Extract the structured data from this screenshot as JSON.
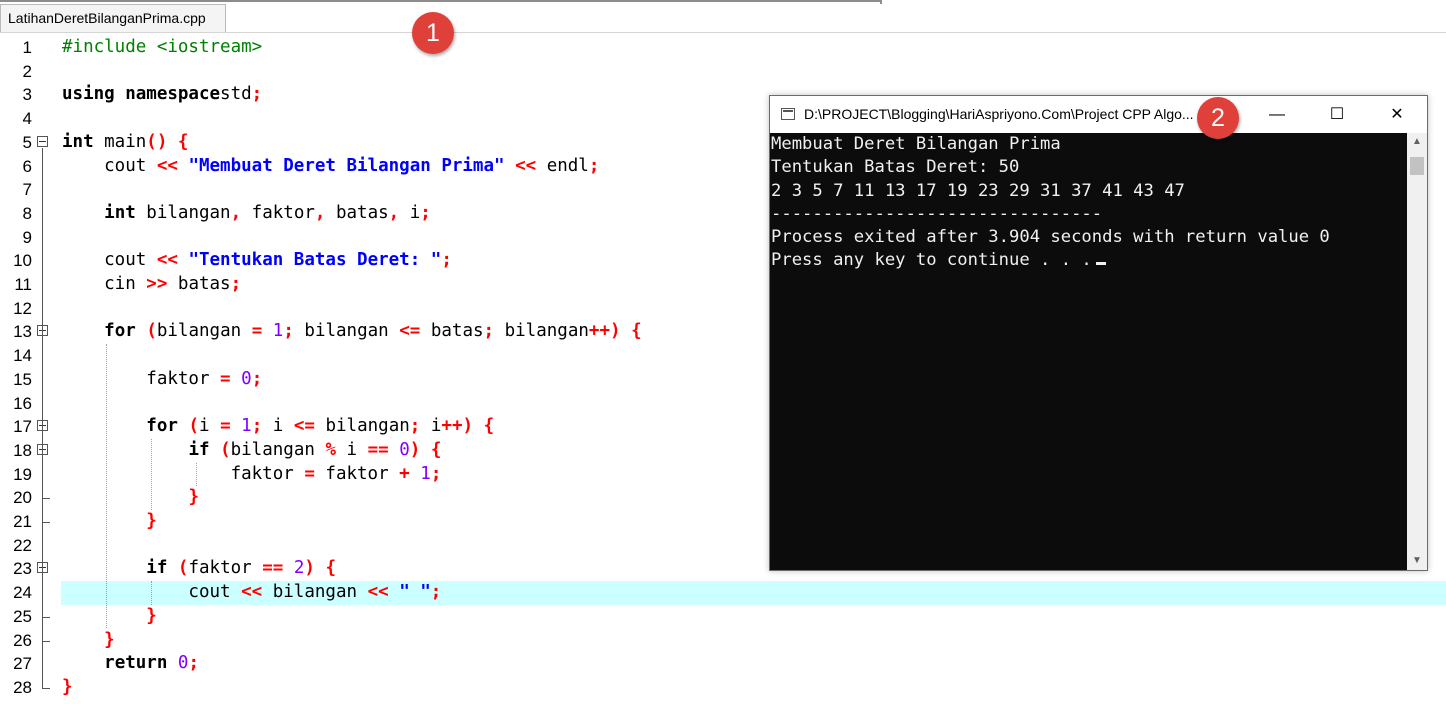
{
  "tab": {
    "filename": "LatihanDeretBilanganPrima.cpp"
  },
  "editor": {
    "highlighted_line": 24,
    "lines": [
      {
        "n": "1",
        "code": [
          [
            "pp",
            "#include <iostream>"
          ]
        ]
      },
      {
        "n": "2",
        "code": []
      },
      {
        "n": "3",
        "code": [
          [
            "kw",
            "using namespace"
          ],
          [
            "",
            "std"
          ],
          [
            "sym",
            ";"
          ]
        ]
      },
      {
        "n": "4",
        "code": []
      },
      {
        "n": "5",
        "code": [
          [
            "kw",
            "int"
          ],
          [
            "",
            " main"
          ],
          [
            "sym",
            "()"
          ],
          [
            "",
            " "
          ],
          [
            "sym",
            "{"
          ]
        ]
      },
      {
        "n": "6",
        "code": [
          [
            "",
            "    cout "
          ],
          [
            "sym",
            "<<"
          ],
          [
            "",
            " "
          ],
          [
            "str",
            "\"Membuat Deret Bilangan Prima\""
          ],
          [
            "",
            " "
          ],
          [
            "sym",
            "<<"
          ],
          [
            "",
            " endl"
          ],
          [
            "sym",
            ";"
          ]
        ]
      },
      {
        "n": "7",
        "code": []
      },
      {
        "n": "8",
        "code": [
          [
            "",
            "    "
          ],
          [
            "kw",
            "int"
          ],
          [
            "",
            " bilangan"
          ],
          [
            "sym",
            ","
          ],
          [
            "",
            " faktor"
          ],
          [
            "sym",
            ","
          ],
          [
            "",
            " batas"
          ],
          [
            "sym",
            ","
          ],
          [
            "",
            " i"
          ],
          [
            "sym",
            ";"
          ]
        ]
      },
      {
        "n": "9",
        "code": []
      },
      {
        "n": "10",
        "code": [
          [
            "",
            "    cout "
          ],
          [
            "sym",
            "<<"
          ],
          [
            "",
            " "
          ],
          [
            "str",
            "\"Tentukan Batas Deret: \""
          ],
          [
            "sym",
            ";"
          ]
        ]
      },
      {
        "n": "11",
        "code": [
          [
            "",
            "    cin "
          ],
          [
            "sym",
            ">>"
          ],
          [
            "",
            " batas"
          ],
          [
            "sym",
            ";"
          ]
        ]
      },
      {
        "n": "12",
        "code": []
      },
      {
        "n": "13",
        "code": [
          [
            "",
            "    "
          ],
          [
            "kw",
            "for"
          ],
          [
            "",
            " "
          ],
          [
            "sym",
            "("
          ],
          [
            "",
            "bilangan "
          ],
          [
            "sym",
            "="
          ],
          [
            "",
            " "
          ],
          [
            "num",
            "1"
          ],
          [
            "sym",
            ";"
          ],
          [
            "",
            " bilangan "
          ],
          [
            "sym",
            "<="
          ],
          [
            "",
            " batas"
          ],
          [
            "sym",
            ";"
          ],
          [
            "",
            " bilangan"
          ],
          [
            "sym",
            "++)"
          ],
          [
            "",
            " "
          ],
          [
            "sym",
            "{"
          ]
        ]
      },
      {
        "n": "14",
        "code": []
      },
      {
        "n": "15",
        "code": [
          [
            "",
            "        faktor "
          ],
          [
            "sym",
            "="
          ],
          [
            "",
            " "
          ],
          [
            "num",
            "0"
          ],
          [
            "sym",
            ";"
          ]
        ]
      },
      {
        "n": "16",
        "code": []
      },
      {
        "n": "17",
        "code": [
          [
            "",
            "        "
          ],
          [
            "kw",
            "for"
          ],
          [
            "",
            " "
          ],
          [
            "sym",
            "("
          ],
          [
            "",
            "i "
          ],
          [
            "sym",
            "="
          ],
          [
            "",
            " "
          ],
          [
            "num",
            "1"
          ],
          [
            "sym",
            ";"
          ],
          [
            "",
            " i "
          ],
          [
            "sym",
            "<="
          ],
          [
            "",
            " bilangan"
          ],
          [
            "sym",
            ";"
          ],
          [
            "",
            " i"
          ],
          [
            "sym",
            "++)"
          ],
          [
            "",
            " "
          ],
          [
            "sym",
            "{"
          ]
        ]
      },
      {
        "n": "18",
        "code": [
          [
            "",
            "            "
          ],
          [
            "kw",
            "if"
          ],
          [
            "",
            " "
          ],
          [
            "sym",
            "("
          ],
          [
            "",
            "bilangan "
          ],
          [
            "sym",
            "%"
          ],
          [
            "",
            " i "
          ],
          [
            "sym",
            "=="
          ],
          [
            "",
            " "
          ],
          [
            "num",
            "0"
          ],
          [
            "sym",
            ")"
          ],
          [
            "",
            " "
          ],
          [
            "sym",
            "{"
          ]
        ]
      },
      {
        "n": "19",
        "code": [
          [
            "",
            "                faktor "
          ],
          [
            "sym",
            "="
          ],
          [
            "",
            " faktor "
          ],
          [
            "sym",
            "+"
          ],
          [
            "",
            " "
          ],
          [
            "num",
            "1"
          ],
          [
            "sym",
            ";"
          ]
        ]
      },
      {
        "n": "20",
        "code": [
          [
            "",
            "            "
          ],
          [
            "sym",
            "}"
          ]
        ]
      },
      {
        "n": "21",
        "code": [
          [
            "",
            "        "
          ],
          [
            "sym",
            "}"
          ]
        ]
      },
      {
        "n": "22",
        "code": []
      },
      {
        "n": "23",
        "code": [
          [
            "",
            "        "
          ],
          [
            "kw",
            "if"
          ],
          [
            "",
            " "
          ],
          [
            "sym",
            "("
          ],
          [
            "",
            "faktor "
          ],
          [
            "sym",
            "=="
          ],
          [
            "",
            " "
          ],
          [
            "num",
            "2"
          ],
          [
            "sym",
            ")"
          ],
          [
            "",
            " "
          ],
          [
            "sym",
            "{"
          ]
        ]
      },
      {
        "n": "24",
        "code": [
          [
            "",
            "            cout "
          ],
          [
            "sym",
            "<<"
          ],
          [
            "",
            " bilangan "
          ],
          [
            "sym",
            "<<"
          ],
          [
            "",
            " "
          ],
          [
            "str",
            "\" \""
          ],
          [
            "sym",
            ";"
          ]
        ]
      },
      {
        "n": "25",
        "code": [
          [
            "",
            "        "
          ],
          [
            "sym",
            "}"
          ]
        ]
      },
      {
        "n": "26",
        "code": [
          [
            "",
            "    "
          ],
          [
            "sym",
            "}"
          ]
        ]
      },
      {
        "n": "27",
        "code": [
          [
            "",
            "    "
          ],
          [
            "kw",
            "return"
          ],
          [
            "",
            " "
          ],
          [
            "num",
            "0"
          ],
          [
            "sym",
            ";"
          ]
        ]
      },
      {
        "n": "28",
        "code": [
          [
            "sym",
            "}"
          ]
        ]
      }
    ]
  },
  "console": {
    "title": "D:\\PROJECT\\Blogging\\HariAspriyono.Com\\Project CPP Algo...",
    "minimize": "—",
    "maximize": "☐",
    "close": "✕",
    "output": [
      "Membuat Deret Bilangan Prima",
      "Tentukan Batas Deret: 50",
      "2 3 5 7 11 13 17 19 23 29 31 37 41 43 47",
      "--------------------------------",
      "Process exited after 3.904 seconds with return value 0",
      "Press any key to continue . . ."
    ]
  },
  "markers": {
    "one": "1",
    "two": "2"
  },
  "colors": {
    "keyword": "#000000",
    "operator": "#ff0000",
    "string": "#0000ff",
    "number": "#8000ff",
    "preprocessor": "#008000",
    "highlight": "#ccffff"
  }
}
